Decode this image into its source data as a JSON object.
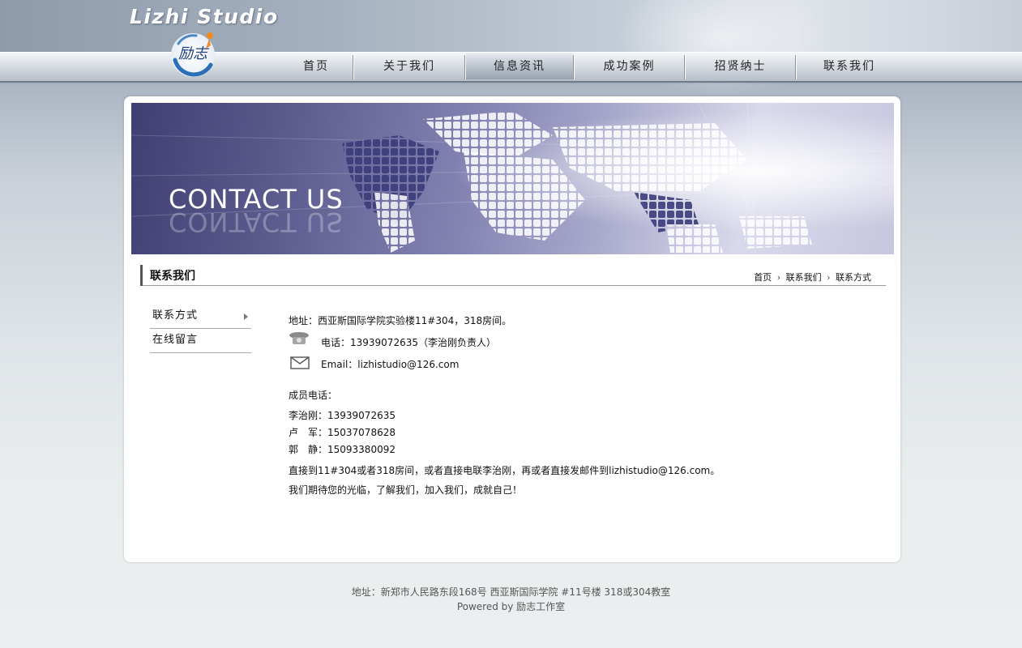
{
  "header": {
    "brand": "Lizhi Studio",
    "logo_text": "励志"
  },
  "nav": {
    "items": [
      {
        "label": "首页"
      },
      {
        "label": "关于我们"
      },
      {
        "label": "信息资讯"
      },
      {
        "label": "成功案例"
      },
      {
        "label": "招贤纳士"
      },
      {
        "label": "联系我们"
      }
    ]
  },
  "banner": {
    "title": "CONTACT US"
  },
  "section": {
    "title": "联系我们",
    "breadcrumb": [
      "首页",
      "联系我们",
      "联系方式"
    ]
  },
  "sidemenu": {
    "items": [
      {
        "label": "联系方式"
      },
      {
        "label": "在线留言"
      }
    ]
  },
  "contact": {
    "address": "地址：西亚斯国际学院实验楼11#304，318房间。",
    "phone": "电话：13939072635（李治刚负责人）",
    "email": "Email：lizhistudio@126.com",
    "members_title": "成员电话：",
    "members": [
      "李治刚：13939072635",
      "卢　军：15037078628",
      "郭　静：15093380092"
    ],
    "note1": "直接到11#304或者318房间，或者直接电联李治刚，再或者直接发邮件到lizhistudio@126.com。",
    "note2": "我们期待您的光临，了解我们，加入我们，成就自己！"
  },
  "footer": {
    "address": "地址：新郑市人民路东段168号  西亚斯国际学院  #11号楼 318或304教室",
    "powered": "Powered by 励志工作室"
  },
  "colors": {
    "banner_purple": "#5a5a8d",
    "text": "#111111",
    "footer_text": "#555555"
  },
  "icons": [
    "telephone-icon",
    "envelope-icon",
    "arrow-right-icon",
    "chevron-right-icon"
  ]
}
